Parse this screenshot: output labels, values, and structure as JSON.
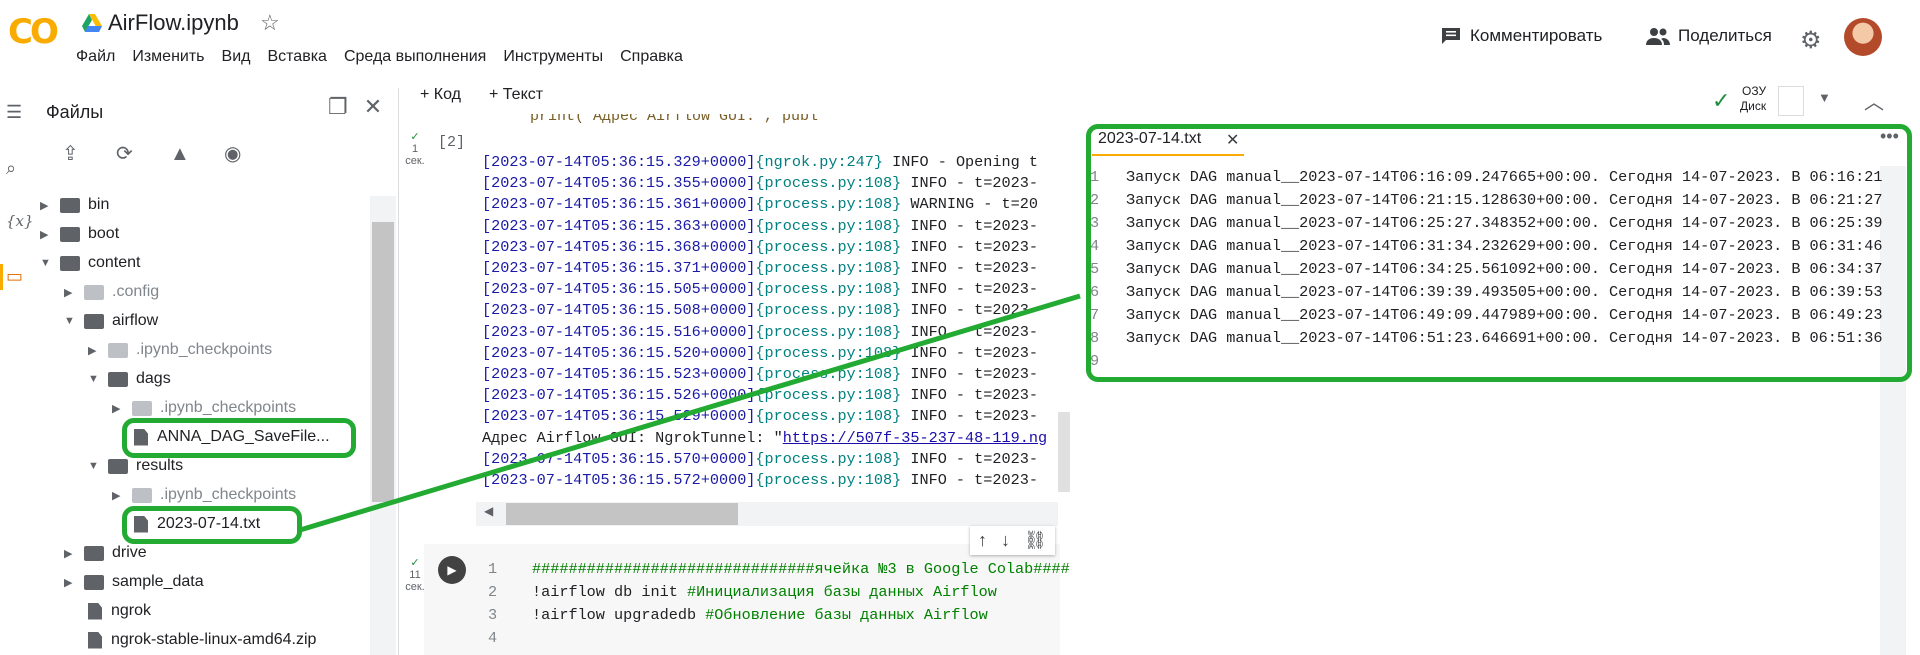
{
  "header": {
    "logo_text": "CO",
    "title": "AirFlow.ipynb",
    "menu": [
      "Файл",
      "Изменить",
      "Вид",
      "Вставка",
      "Среда выполнения",
      "Инструменты",
      "Справка"
    ],
    "comment_label": "Комментировать",
    "share_label": "Поделиться"
  },
  "files_panel": {
    "title": "Файлы",
    "tree": [
      {
        "label": "bin",
        "type": "folder"
      },
      {
        "label": "boot",
        "type": "folder"
      },
      {
        "label": "content",
        "type": "folder"
      },
      {
        "label": ".config",
        "type": "folder"
      },
      {
        "label": "airflow",
        "type": "folder"
      },
      {
        "label": ".ipynb_checkpoints",
        "type": "folder"
      },
      {
        "label": "dags",
        "type": "folder"
      },
      {
        "label": ".ipynb_checkpoints",
        "type": "folder"
      },
      {
        "label": "ANNA_DAG_SaveFile...",
        "type": "file"
      },
      {
        "label": "results",
        "type": "folder"
      },
      {
        "label": ".ipynb_checkpoints",
        "type": "folder"
      },
      {
        "label": "2023-07-14.txt",
        "type": "file"
      },
      {
        "label": "drive",
        "type": "folder"
      },
      {
        "label": "sample_data",
        "type": "folder"
      },
      {
        "label": "ngrok",
        "type": "file"
      },
      {
        "label": "ngrok-stable-linux-amd64.zip",
        "type": "file"
      }
    ]
  },
  "toolbar": {
    "code_label": "+ Код",
    "text_label": "+ Текст",
    "ram_label": "ОЗУ",
    "disk_label": "Диск"
  },
  "cell2": {
    "status_num": "1",
    "status_unit": "сек.",
    "exec_count": "[2]",
    "top_code": "print(\"Адрес Airflow GUI:\", publ",
    "output": [
      {
        "ts": "[2023-07-14T05:36:15.329+0000]",
        "src": "{ngrok.py:247}",
        "msg": " INFO - Opening t"
      },
      {
        "ts": "[2023-07-14T05:36:15.355+0000]",
        "src": "{process.py:108}",
        "msg": " INFO - t=2023-"
      },
      {
        "ts": "[2023-07-14T05:36:15.361+0000]",
        "src": "{process.py:108}",
        "msg": " WARNING - t=20"
      },
      {
        "ts": "[2023-07-14T05:36:15.363+0000]",
        "src": "{process.py:108}",
        "msg": " INFO - t=2023-"
      },
      {
        "ts": "[2023-07-14T05:36:15.368+0000]",
        "src": "{process.py:108}",
        "msg": " INFO - t=2023-"
      },
      {
        "ts": "[2023-07-14T05:36:15.371+0000]",
        "src": "{process.py:108}",
        "msg": " INFO - t=2023-"
      },
      {
        "ts": "[2023-07-14T05:36:15.505+0000]",
        "src": "{process.py:108}",
        "msg": " INFO - t=2023-"
      },
      {
        "ts": "[2023-07-14T05:36:15.508+0000]",
        "src": "{process.py:108}",
        "msg": " INFO - t=2023-"
      },
      {
        "ts": "[2023-07-14T05:36:15.516+0000]",
        "src": "{process.py:108}",
        "msg": " INFO - t=2023-"
      },
      {
        "ts": "[2023-07-14T05:36:15.520+0000]",
        "src": "{process.py:108}",
        "msg": " INFO - t=2023-"
      },
      {
        "ts": "[2023-07-14T05:36:15.523+0000]",
        "src": "{process.py:108}",
        "msg": " INFO - t=2023-"
      },
      {
        "ts": "[2023-07-14T05:36:15.526+0000]",
        "src": "{process.py:108}",
        "msg": " INFO - t=2023-"
      },
      {
        "ts": "[2023-07-14T05:36:15.529+0000]",
        "src": "{process.py:108}",
        "msg": " INFO - t=2023-"
      },
      {
        "plain": "Адрес Airflow GUI: NgrokTunnel: \"",
        "link": "https://507f-35-237-48-119.ng"
      },
      {
        "ts": "[2023-07-14T05:36:15.570+0000]",
        "src": "{process.py:108}",
        "msg": " INFO - t=2023-"
      },
      {
        "ts": "[2023-07-14T05:36:15.572+0000]",
        "src": "{process.py:108}",
        "msg": " INFO - t=2023-"
      }
    ]
  },
  "cell3": {
    "status_num": "11",
    "status_unit": "сек.",
    "lines": [
      {
        "n": "1",
        "code": "",
        "comment": "###############################ячейка №3 в Google Colab####"
      },
      {
        "n": "2",
        "code": "!airflow db init ",
        "comment": "#Инициализация базы данных Airflow"
      },
      {
        "n": "3",
        "code": "!airflow upgradedb ",
        "comment": "#Обновление базы данных Airflow"
      },
      {
        "n": "4",
        "code": "",
        "comment": ""
      }
    ]
  },
  "editor": {
    "tab_label": "2023-07-14.txt",
    "lines": [
      {
        "n": "1",
        "text": "Запуск DAG manual__2023-07-14T06:16:09.247665+00:00. Сегодня 14-07-2023. В 06:16:21"
      },
      {
        "n": "2",
        "text": "Запуск DAG manual__2023-07-14T06:21:15.128630+00:00. Сегодня 14-07-2023. В 06:21:27"
      },
      {
        "n": "3",
        "text": "Запуск DAG manual__2023-07-14T06:25:27.348352+00:00. Сегодня 14-07-2023. В 06:25:39"
      },
      {
        "n": "4",
        "text": "Запуск DAG manual__2023-07-14T06:31:34.232629+00:00. Сегодня 14-07-2023. В 06:31:46"
      },
      {
        "n": "5",
        "text": "Запуск DAG manual__2023-07-14T06:34:25.561092+00:00. Сегодня 14-07-2023. В 06:34:37"
      },
      {
        "n": "6",
        "text": "Запуск DAG manual__2023-07-14T06:39:39.493505+00:00. Сегодня 14-07-2023. В 06:39:53"
      },
      {
        "n": "7",
        "text": "Запуск DAG manual__2023-07-14T06:49:09.447989+00:00. Сегодня 14-07-2023. В 06:49:23"
      },
      {
        "n": "8",
        "text": "Запуск DAG manual__2023-07-14T06:51:23.646691+00:00. Сегодня 14-07-2023. В 06:51:36"
      },
      {
        "n": "9",
        "text": ""
      }
    ]
  },
  "colors": {
    "annotation": "#22aa33",
    "accent": "#f9ab00"
  }
}
